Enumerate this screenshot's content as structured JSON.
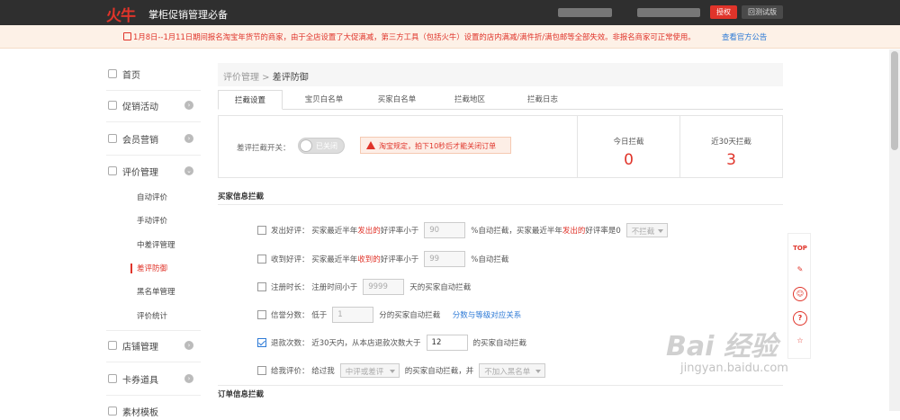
{
  "top": {
    "logo": "火牛",
    "brand": "掌柜促销管理必备",
    "auth_btn": "授权",
    "back_btn": "回测试版"
  },
  "notice": {
    "text": "1月8日--1月11日期间报名淘宝年货节的商家，由于全店设置了大促满减，第三方工具（包括火牛）设置的店内满减/满件折/满包邮等全部失效。非报名商家可正常使用。",
    "link": "查看官方公告"
  },
  "sidebar": {
    "items": [
      {
        "label": "首页"
      },
      {
        "label": "促销活动",
        "arrow": "›"
      },
      {
        "label": "会员营销",
        "arrow": "›"
      },
      {
        "label": "评价管理",
        "arrow": "⌄"
      },
      {
        "label": "店铺管理",
        "arrow": "›"
      },
      {
        "label": "卡券道具",
        "arrow": "›"
      },
      {
        "label": "素材模板"
      }
    ],
    "sub": [
      "自动评价",
      "手动评价",
      "中差评管理",
      "差评防御",
      "黑名单管理",
      "评价统计"
    ]
  },
  "breadcrumb": {
    "parent": "评价管理",
    "sep": " > ",
    "current": "差评防御"
  },
  "tabs": [
    "拦截设置",
    "宝贝白名单",
    "买家白名单",
    "拦截地区",
    "拦截日志"
  ],
  "panel": {
    "switch_label": "差评拦截开关：",
    "switch_state": "已关闭",
    "warning": "淘宝规定，拍下10秒后才能关闭订单",
    "stats": [
      {
        "label": "今日拦截",
        "value": "0"
      },
      {
        "label": "近30天拦截",
        "value": "3"
      }
    ]
  },
  "sections": {
    "buyer": "买家信息拦截",
    "order": "订单信息拦截"
  },
  "rows": {
    "r1": {
      "label": "发出好评：",
      "a": "买家最近半年",
      "b": "发出的",
      "c": "好评率小于",
      "val": "90",
      "d": "%自动拦截，买家最近半年",
      "e": "发出的",
      "f": "好评率是0",
      "sel": "不拦截"
    },
    "r2": {
      "label": "收到好评：",
      "a": "买家最近半年",
      "b": "收到的",
      "c": "好评率小于",
      "val": "99",
      "d": "%自动拦截"
    },
    "r3": {
      "label": "注册时长：",
      "a": "注册时间小于",
      "val": "9999",
      "d": "天的买家自动拦截"
    },
    "r4": {
      "label": "信誉分数：",
      "a": "低于",
      "val": "1",
      "d": "分的买家自动拦截",
      "link": "分数与等级对应关系"
    },
    "r5": {
      "label": "退款次数：",
      "a": "近30天内，从本店退款次数大于",
      "val": "12",
      "d": "的买家自动拦截"
    },
    "r6": {
      "label": "给我评价：",
      "a": "给过我",
      "sel1": "中评或差评",
      "d": "的买家自动拦截，并",
      "sel2": "不加入黑名单"
    }
  },
  "float": {
    "top": "TOP"
  },
  "watermark": {
    "brand": "Bai 经验",
    "url": "jingyan.baidu.com"
  }
}
